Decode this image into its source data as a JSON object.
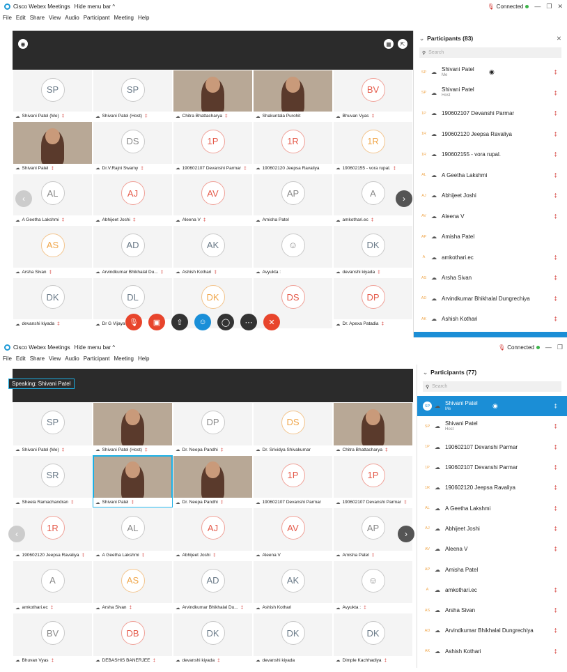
{
  "w1": {
    "title": "Cisco Webex Meetings",
    "hide": "Hide menu bar ^",
    "connected": "Connected",
    "menu": [
      "File",
      "Edit",
      "Share",
      "View",
      "Audio",
      "Participant",
      "Meeting",
      "Help"
    ],
    "participants_title": "Participants (83)",
    "search": "Search",
    "tiles": [
      {
        "av": "SP",
        "c": "b",
        "label": "Shivani Patel (Me)"
      },
      {
        "av": "SP",
        "c": "b",
        "label": "Shivani Patel (Host)"
      },
      {
        "video": true,
        "label": "Chitra Bhattacharya"
      },
      {
        "video": true,
        "label": "Shakuntala Purohit"
      },
      {
        "av": "BV",
        "c": "r",
        "label": "Bhuvan Vyas"
      },
      {
        "video": true,
        "label": "Shivani Patel"
      },
      {
        "av": "DS",
        "c": "g",
        "label": "Dr.V.Rajni Swamy"
      },
      {
        "av": "1P",
        "c": "r",
        "label": "190602107 Devanshi Parmar"
      },
      {
        "av": "1R",
        "c": "r",
        "label": "190602120 Jeepsa Ravaliya"
      },
      {
        "av": "1R",
        "c": "o",
        "label": "190602155 - vora rupal."
      },
      {
        "av": "AL",
        "c": "g",
        "label": "A Geetha Lakshmi"
      },
      {
        "av": "AJ",
        "c": "r",
        "label": "Abhijeet Joshi"
      },
      {
        "av": "AV",
        "c": "r",
        "label": "Aleena V"
      },
      {
        "av": "AP",
        "c": "g",
        "label": "Amisha Patel"
      },
      {
        "av": "A",
        "c": "g",
        "label": "amkothari.ec"
      },
      {
        "av": "AS",
        "c": "o",
        "label": "Arsha Sivan"
      },
      {
        "av": "AD",
        "c": "b",
        "label": "Arvindkumar Bhikhalal Du..."
      },
      {
        "av": "AK",
        "c": "b",
        "label": "Ashish Kothari"
      },
      {
        "av": "",
        "c": "g",
        "label": "Avyukta :"
      },
      {
        "av": "DK",
        "c": "b",
        "label": "devanshi kiyada"
      },
      {
        "av": "DK",
        "c": "b",
        "label": "devanshi kiyada"
      },
      {
        "av": "DL",
        "c": "b",
        "label": "Dr G Vijaya"
      },
      {
        "av": "DK",
        "c": "o",
        "label": ""
      },
      {
        "av": "DS",
        "c": "r",
        "label": ""
      },
      {
        "av": "DP",
        "c": "r",
        "label": "Dr. Apexa Patadia"
      }
    ],
    "plist": [
      {
        "i": "SP",
        "name": "Shivani Patel",
        "sub": "Me",
        "mic": true
      },
      {
        "i": "SP",
        "name": "Shivani Patel",
        "sub": "Host",
        "mic": true
      },
      {
        "i": "1P",
        "name": "190602107 Devanshi Parmar",
        "mic": true
      },
      {
        "i": "1R",
        "name": "190602120 Jeepsa Ravaliya",
        "mic": true
      },
      {
        "i": "1R",
        "name": "190602155 - vora rupal.",
        "mic": true
      },
      {
        "i": "AL",
        "name": "A Geetha Lakshmi",
        "mic": true
      },
      {
        "i": "AJ",
        "name": "Abhijeet Joshi",
        "mic": true
      },
      {
        "i": "AV",
        "name": "Aleena V",
        "mic": true
      },
      {
        "i": "AP",
        "name": "Amisha Patel",
        "mic": false
      },
      {
        "i": "A",
        "name": "amkothari.ec",
        "mic": true
      },
      {
        "i": "AS",
        "name": "Arsha Sivan",
        "mic": true
      },
      {
        "i": "AD",
        "name": "Arvindkumar Bhikhalal Dungrechiya",
        "mic": true
      },
      {
        "i": "AK",
        "name": "Ashish Kothari",
        "mic": true
      }
    ]
  },
  "w2": {
    "title": "Cisco Webex Meetings",
    "hide": "Hide menu bar ^",
    "connected": "Connected",
    "menu": [
      "File",
      "Edit",
      "Share",
      "View",
      "Audio",
      "Participant",
      "Meeting",
      "Help"
    ],
    "speaking": "Speaking: Shivani Patel",
    "participants_title": "Participants (77)",
    "search": "Search",
    "tiles": [
      {
        "av": "SP",
        "c": "b",
        "label": "Shivani Patel (Me)"
      },
      {
        "video": true,
        "label": "Shivani Patel (Host)"
      },
      {
        "av": "DP",
        "c": "g",
        "label": "Dr. Neepa Pandhi"
      },
      {
        "av": "DS",
        "c": "o",
        "label": "Dr. Srividya Shivakumar"
      },
      {
        "video": true,
        "label": "Chitra Bhattacharya"
      },
      {
        "av": "SR",
        "c": "b",
        "label": "Sheela Ramachandran"
      },
      {
        "video": true,
        "active": true,
        "label": "Shivani Patel"
      },
      {
        "video": true,
        "label": "Dr. Neepa Pandhi"
      },
      {
        "av": "1P",
        "c": "r",
        "label": "190602107 Devanshi Parmar"
      },
      {
        "av": "1P",
        "c": "r",
        "label": "190602107 Devanshi Parmar"
      },
      {
        "av": "1R",
        "c": "r",
        "label": "190602120 Jeepsa Ravaliya"
      },
      {
        "av": "AL",
        "c": "g",
        "label": "A Geetha Lakshmi"
      },
      {
        "av": "AJ",
        "c": "r",
        "label": "Abhijeet Joshi"
      },
      {
        "av": "AV",
        "c": "r",
        "label": "Aleena V"
      },
      {
        "av": "AP",
        "c": "g",
        "label": "Amisha Patel"
      },
      {
        "av": "A",
        "c": "g",
        "label": "amkothari.ec"
      },
      {
        "av": "AS",
        "c": "o",
        "label": "Arsha Sivan"
      },
      {
        "av": "AD",
        "c": "b",
        "label": "Arvindkumar Bhikhalal Du..."
      },
      {
        "av": "AK",
        "c": "b",
        "label": "Ashish Kothari"
      },
      {
        "av": "",
        "c": "g",
        "label": "Avyukta :"
      },
      {
        "av": "BV",
        "c": "g",
        "label": "Bhuvan Vyas"
      },
      {
        "av": "DB",
        "c": "r",
        "label": "DEBASHIS BANERJEE"
      },
      {
        "av": "DK",
        "c": "b",
        "label": "devanshi kiyada"
      },
      {
        "av": "DK",
        "c": "b",
        "label": "devanshi kiyada"
      },
      {
        "av": "DK",
        "c": "b",
        "label": "Dimple Kachhadiya"
      }
    ],
    "plist": [
      {
        "i": "SP",
        "name": "Shivani Patel",
        "sub": "Me",
        "mic": true,
        "sel": true
      },
      {
        "i": "SP",
        "name": "Shivani Patel",
        "sub": "Host",
        "mic": true
      },
      {
        "i": "1P",
        "name": "190602107 Devanshi Parmar",
        "mic": true
      },
      {
        "i": "1P",
        "name": "190602107 Devanshi Parmar",
        "mic": true
      },
      {
        "i": "1R",
        "name": "190602120 Jeepsa Ravaliya",
        "mic": true
      },
      {
        "i": "AL",
        "name": "A Geetha Lakshmi",
        "mic": true
      },
      {
        "i": "AJ",
        "name": "Abhijeet Joshi",
        "mic": true
      },
      {
        "i": "AV",
        "name": "Aleena V",
        "mic": true
      },
      {
        "i": "AP",
        "name": "Amisha Patel",
        "mic": false
      },
      {
        "i": "A",
        "name": "amkothari.ec",
        "mic": true
      },
      {
        "i": "AS",
        "name": "Arsha Sivan",
        "mic": true
      },
      {
        "i": "AD",
        "name": "Arvindkumar Bhikhalal Dungrechiya",
        "mic": true
      },
      {
        "i": "AK",
        "name": "Ashish Kothari",
        "mic": true
      }
    ]
  }
}
